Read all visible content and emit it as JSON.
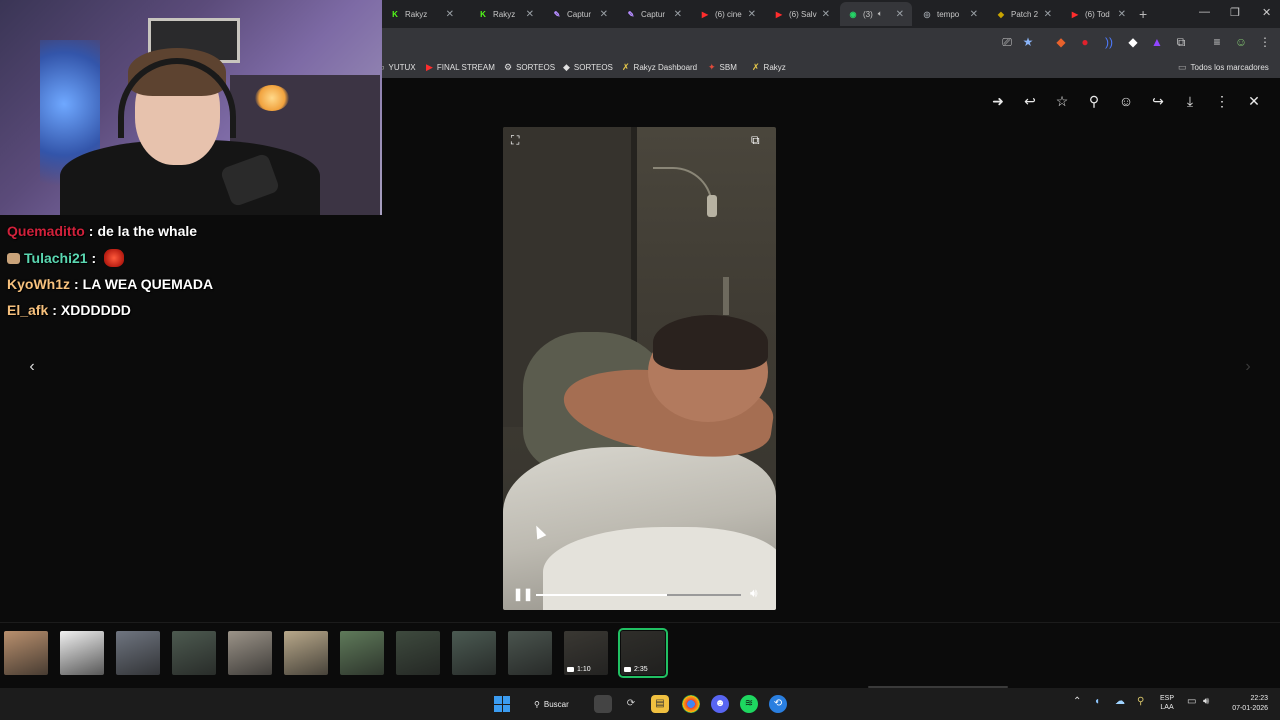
{
  "browser": {
    "tabs": [
      {
        "label": "Rakyz",
        "icon": "kick-icon",
        "color": "#53fc18",
        "active": false
      },
      {
        "label": "Rakyz",
        "icon": "kick-icon",
        "color": "#53fc18",
        "active": false
      },
      {
        "label": "Captur",
        "icon": "feather-icon",
        "color": "#b58cff",
        "active": false
      },
      {
        "label": "Captur",
        "icon": "feather-icon",
        "color": "#b58cff",
        "active": false
      },
      {
        "label": "(6) cine",
        "icon": "youtube-icon",
        "color": "#ff2d2d",
        "active": false
      },
      {
        "label": "(6) Salv",
        "icon": "youtube-icon",
        "color": "#ff2d2d",
        "active": false
      },
      {
        "label": "(3)",
        "icon": "whatsapp-icon",
        "color": "#25d366",
        "active": true
      },
      {
        "label": "tempo",
        "icon": "globe-icon",
        "color": "#9aa0a6",
        "active": false
      },
      {
        "label": "Patch 2",
        "icon": "patch-icon",
        "color": "#c8a400",
        "active": false
      },
      {
        "label": "(6) Tod",
        "icon": "youtube-icon",
        "color": "#ff2d2d",
        "active": false
      }
    ],
    "bookmarks": [
      {
        "label": "YUTUX",
        "icon": "folder-icon"
      },
      {
        "label": "FINAL STREAM",
        "icon": "youtube-icon"
      },
      {
        "label": "SORTEOS",
        "icon": "gear-icon"
      },
      {
        "label": "SORTEOS",
        "icon": "diamond-icon"
      },
      {
        "label": "Rakyz Dashboard",
        "icon": "rakyz-icon"
      },
      {
        "label": "SBM",
        "icon": "sbm-icon"
      },
      {
        "label": "Rakyz",
        "icon": "rakyz-icon"
      }
    ],
    "all_bookmarks_label": "Todos los marcadores"
  },
  "chat": [
    {
      "user": "Quemaditto",
      "color": "#d1213b",
      "message": "de la the whale",
      "badge": false,
      "emote": false
    },
    {
      "user": "Tulachi21",
      "color": "#5ad7b1",
      "message": "",
      "badge": true,
      "emote": true
    },
    {
      "user": "KyoWh1z",
      "color": "#f7c17d",
      "message": "LA WEA QUEMADA",
      "badge": false,
      "emote": false
    },
    {
      "user": "El_afk",
      "color": "#f7c17d",
      "message": "XDDDDDD",
      "badge": false,
      "emote": false
    }
  ],
  "video": {
    "progress": 0.64
  },
  "thumbnails": [
    {
      "kind": "image",
      "color": "#b9906e"
    },
    {
      "kind": "image",
      "color": "#f0f0f0"
    },
    {
      "kind": "image",
      "color": "#6f7580"
    },
    {
      "kind": "image",
      "color": "#4d5a50"
    },
    {
      "kind": "image",
      "color": "#9b9388"
    },
    {
      "kind": "image",
      "color": "#b8a88a"
    },
    {
      "kind": "image",
      "color": "#5f7a5a"
    },
    {
      "kind": "image",
      "color": "#3e4a3e"
    },
    {
      "kind": "image",
      "color": "#4b5a52"
    },
    {
      "kind": "image",
      "color": "#4a544e"
    },
    {
      "kind": "video",
      "color": "#3a3833",
      "duration": "1:10"
    },
    {
      "kind": "video",
      "color": "#2f2e2a",
      "duration": "2:35",
      "selected": true
    }
  ],
  "taskbar": {
    "search_label": "Buscar",
    "language": "ESP",
    "region": "LAA",
    "time": "22:23",
    "date": "07-01-2026"
  }
}
